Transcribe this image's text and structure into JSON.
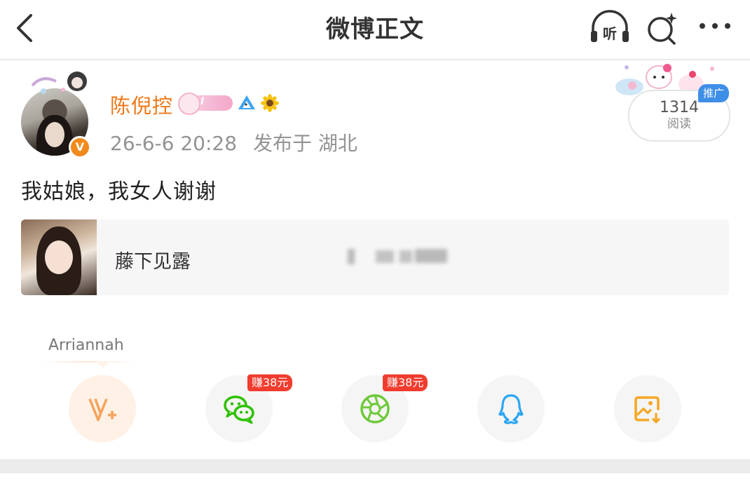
{
  "nav": {
    "title": "微博正文",
    "listen_label": "听"
  },
  "post": {
    "username": "陈倪控",
    "badge_level": "I",
    "time": "26-6-6 20:28",
    "location": "发布于 湖北",
    "text": "我姑娘，我女人谢谢",
    "read_count": "1314",
    "read_label": "阅读",
    "promo_tag": "推广",
    "verify_mark": "V"
  },
  "link_card": {
    "title": "藤下见露"
  },
  "share": {
    "tip_label": "Arriannah",
    "earn_wechat": "赚38元",
    "earn_moments": "赚38元",
    "items": [
      {
        "name": "vplus",
        "icon": "v-plus-icon"
      },
      {
        "name": "wechat",
        "icon": "wechat-icon"
      },
      {
        "name": "moments",
        "icon": "moments-icon"
      },
      {
        "name": "qq",
        "icon": "qq-icon"
      },
      {
        "name": "save-image",
        "icon": "save-image-icon"
      }
    ]
  },
  "colors": {
    "accent": "#f07818",
    "promo": "#3d8ee7",
    "earn": "#f03c2e",
    "wechat": "#2dc100",
    "moments": "#6dc93a",
    "qq": "#2ca6f4",
    "save": "#f5a623"
  }
}
